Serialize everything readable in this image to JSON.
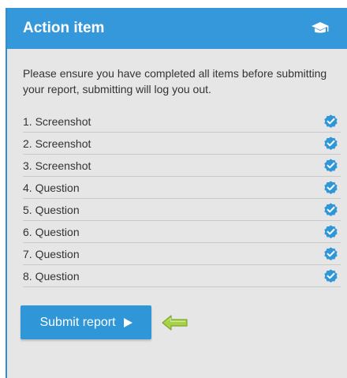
{
  "colors": {
    "accent": "#3498db",
    "panel_bg": "#e6e6e6",
    "check": "#2f96d8",
    "arrow": "#9ccc3c"
  },
  "header": {
    "title": "Action item",
    "icon": "graduation-cap-icon"
  },
  "intro": "Please ensure you have completed all items before submitting your report, submitting will log you out.",
  "items": [
    {
      "label": "1. Screenshot",
      "icon": "check-badge-icon"
    },
    {
      "label": "2. Screenshot",
      "icon": "check-badge-icon"
    },
    {
      "label": "3. Screenshot",
      "icon": "check-badge-icon"
    },
    {
      "label": "4. Question",
      "icon": "check-badge-icon"
    },
    {
      "label": "5. Question",
      "icon": "check-badge-icon"
    },
    {
      "label": "6. Question",
      "icon": "check-badge-icon"
    },
    {
      "label": "7. Question",
      "icon": "check-badge-icon"
    },
    {
      "label": "8. Question",
      "icon": "check-badge-icon"
    }
  ],
  "submit": {
    "label": "Submit report",
    "icon": "play-icon"
  },
  "pointer": {
    "icon": "left-arrow-icon"
  }
}
